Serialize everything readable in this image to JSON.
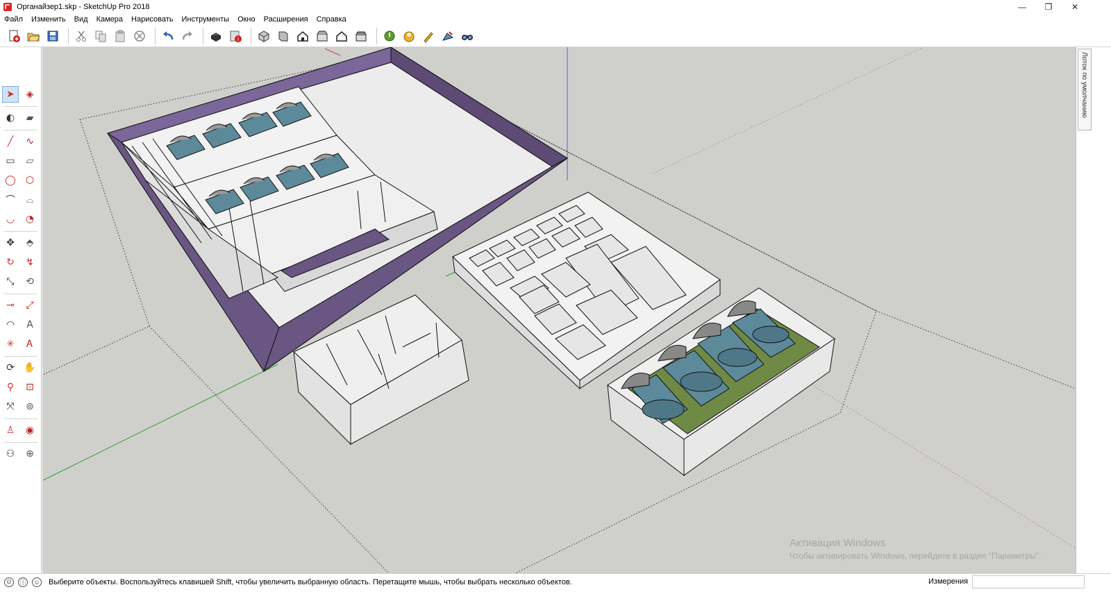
{
  "window": {
    "title": "Органайзер1.skp - SketchUp Pro 2018",
    "minimize_glyph": "—",
    "maximize_glyph": "❐",
    "close_glyph": "✕"
  },
  "menu": [
    {
      "label": "Файл"
    },
    {
      "label": "Изменить"
    },
    {
      "label": "Вид"
    },
    {
      "label": "Камера"
    },
    {
      "label": "Нарисовать"
    },
    {
      "label": "Инструменты"
    },
    {
      "label": "Окно"
    },
    {
      "label": "Расширения"
    },
    {
      "label": "Справка"
    }
  ],
  "toolbar": {
    "icons": [
      "new-file-icon",
      "open-icon",
      "save-icon",
      "cut-icon",
      "copy-icon",
      "paste-icon",
      "delete-icon",
      "undo-icon",
      "redo-icon",
      "print-icon",
      "model-info-icon",
      "iso-view-icon",
      "top-view-icon",
      "front-view-icon",
      "right-view-icon",
      "back-view-icon",
      "left-view-icon",
      "warehouse-icon",
      "extension-warehouse-icon",
      "layout-icon",
      "style-builder-icon",
      "find-icon"
    ]
  },
  "palette": {
    "tools": [
      "select-icon",
      "component-icon",
      "paint-bucket-icon",
      "eraser-icon",
      "line-icon",
      "freehand-icon",
      "rectangle-icon",
      "rotated-rectangle-icon",
      "circle-icon",
      "polygon-icon",
      "arc-icon",
      "two-point-arc-icon",
      "three-point-arc-icon",
      "pie-icon",
      "move-icon",
      "push-pull-icon",
      "rotate-icon",
      "follow-me-icon",
      "scale-icon",
      "offset-icon",
      "tape-measure-icon",
      "dimension-icon",
      "protractor-icon",
      "text-icon",
      "axes-icon",
      "3d-text-icon",
      "orbit-icon",
      "pan-icon",
      "zoom-icon",
      "zoom-window-icon",
      "zoom-extents-icon",
      "previous-view-icon",
      "position-camera-icon",
      "look-around-icon",
      "walk-icon",
      "section-plane-icon"
    ]
  },
  "viewport": {
    "background": "#cfd0cc",
    "box_color": "#6a5682",
    "card_color": "#5d8a9a",
    "green_color": "#6f8a45",
    "watermark_title": "Активация Windows",
    "watermark_subtitle": "Чтобы активировать Windows, перейдите в раздел \"Параметры\"."
  },
  "tray": {
    "label": "Лоток по умолчанию"
  },
  "status": {
    "icons": [
      "geo-location-icon",
      "credits-icon",
      "user-icon"
    ],
    "message": "Выберите объекты. Воспользуйтесь клавишей Shift, чтобы увеличить выбранную область. Перетащите мышь, чтобы выбрать несколько объектов.",
    "measure_label": "Измерения",
    "measure_value": ""
  }
}
